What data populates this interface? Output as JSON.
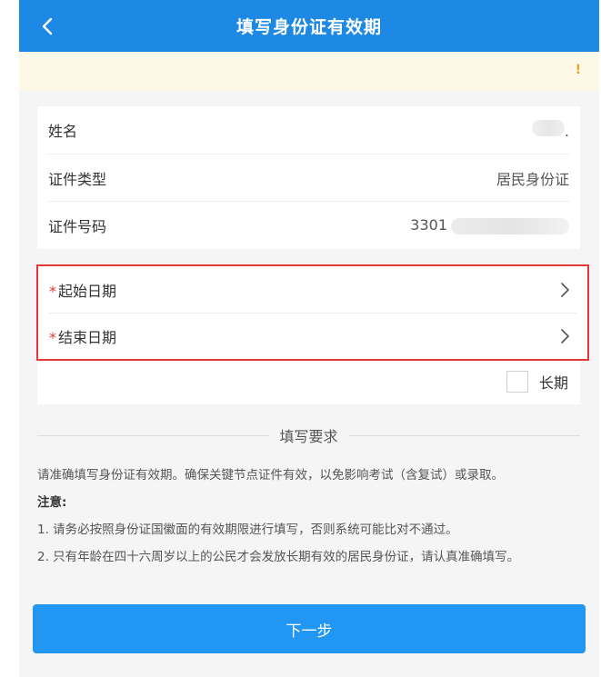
{
  "header": {
    "title": "填写身份证有效期"
  },
  "notice": {
    "mark": "!"
  },
  "info": {
    "name_label": "姓名",
    "name_value_suffix": ".",
    "type_label": "证件类型",
    "type_value": "居民身份证",
    "id_label": "证件号码",
    "id_value_prefix": "3301"
  },
  "dates": {
    "required_mark": "*",
    "start_label": "起始日期",
    "end_label": "结束日期"
  },
  "longterm": {
    "label": "长期",
    "checked": false
  },
  "requirements": {
    "title": "填写要求",
    "intro": "请准确填写身份证有效期。确保关键节点证件有效，以免影响考试（含复试）或录取。",
    "note_label": "注意:",
    "note1": "1. 请务必按照身份证国徽面的有效期限进行填写，否则系统可能比对不通过。",
    "note2": "2. 只有年龄在四十六周岁以上的公民才会发放长期有效的居民身份证，请认真准确填写。"
  },
  "actions": {
    "next_label": "下一步"
  },
  "colors": {
    "header_bg": "#1e88e5",
    "button_bg": "#2196f3",
    "required": "#e53935",
    "notice_bg": "#fef9e6"
  }
}
